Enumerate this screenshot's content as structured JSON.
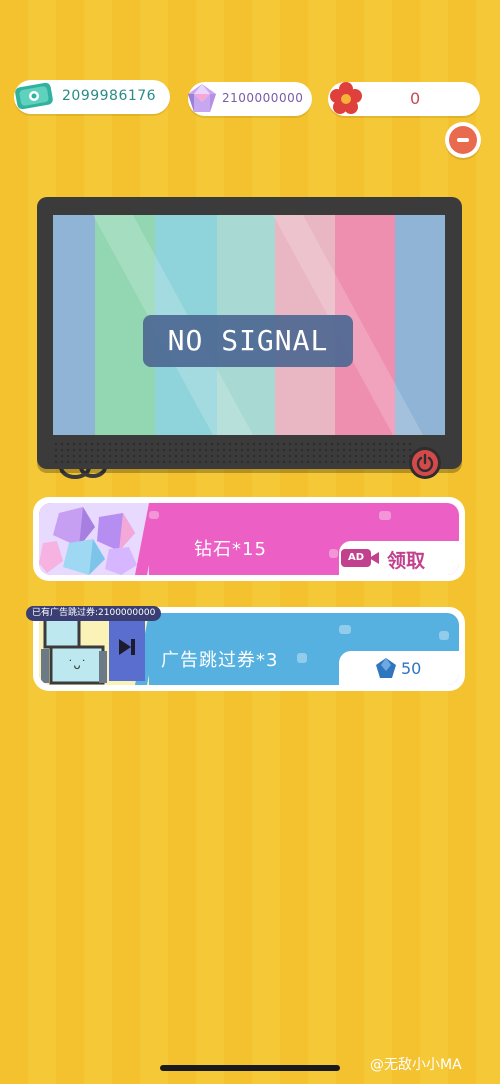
{
  "currencies": {
    "cash": {
      "value": "2099986176",
      "icon": "cash-icon",
      "color": "#2fb39f"
    },
    "gems": {
      "value": "2100000000",
      "icon": "gem-icon",
      "color": "#9b7cd0"
    },
    "flowers": {
      "value": "0",
      "icon": "flower-icon",
      "color": "#e0403c"
    }
  },
  "tv": {
    "screen_text": "NO SIGNAL",
    "stripe_colors": [
      "#8fb4d6",
      "#92d6b2",
      "#8fd3db",
      "#a9d9d3",
      "#e9b6c3",
      "#ee8fb0",
      "#8fb4d6"
    ],
    "power_icon": "power-icon"
  },
  "offers": [
    {
      "title": "钻石*15",
      "action_label": "领取",
      "action_badge": "AD",
      "band_color": "#ec5fc4"
    },
    {
      "owned_tag": "已有广告跳过券:2100000000",
      "title": "广告跳过券*3",
      "price": "50",
      "price_icon": "gem-icon",
      "band_color": "#56b1e1"
    }
  ],
  "watermark": "@无敌小小MA"
}
